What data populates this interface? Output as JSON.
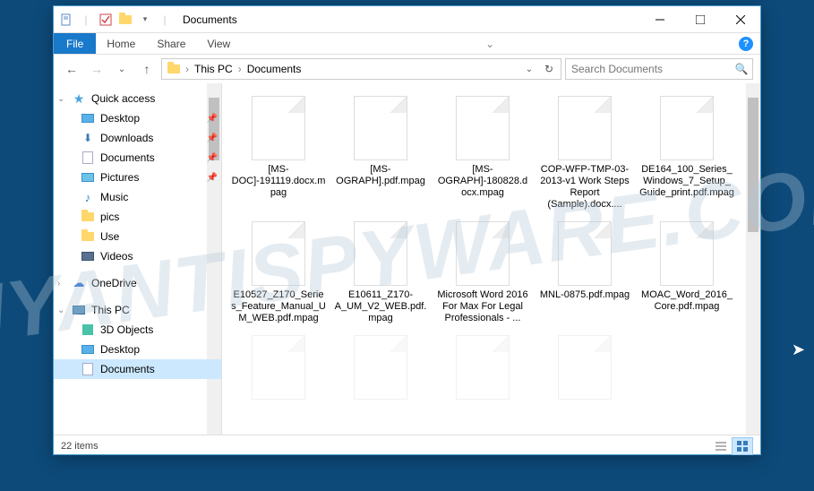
{
  "title": "Documents",
  "ribbon": {
    "file": "File",
    "home": "Home",
    "share": "Share",
    "view": "View"
  },
  "breadcrumb": {
    "root": "This PC",
    "current": "Documents"
  },
  "search": {
    "placeholder": "Search Documents"
  },
  "sidebar": {
    "quick": "Quick access",
    "pinned": [
      {
        "label": "Desktop"
      },
      {
        "label": "Downloads"
      },
      {
        "label": "Documents"
      },
      {
        "label": "Pictures"
      }
    ],
    "recent": [
      {
        "label": "Music"
      },
      {
        "label": "pics"
      },
      {
        "label": "Use"
      },
      {
        "label": "Videos"
      }
    ],
    "onedrive": "OneDrive",
    "thispc": "This PC",
    "pc_children": [
      {
        "label": "3D Objects"
      },
      {
        "label": "Desktop"
      },
      {
        "label": "Documents"
      }
    ]
  },
  "files": [
    {
      "name": "[MS-DOC]-191119.docx.mpag"
    },
    {
      "name": "[MS-OGRAPH].pdf.mpag"
    },
    {
      "name": "[MS-OGRAPH]-180828.docx.mpag"
    },
    {
      "name": "COP-WFP-TMP-03-2013-v1 Work Steps Report (Sample).docx...."
    },
    {
      "name": "DE164_100_Series_Windows_7_Setup_Guide_print.pdf.mpag"
    },
    {
      "name": "E10527_Z170_Series_Feature_Manual_UM_WEB.pdf.mpag"
    },
    {
      "name": "E10611_Z170-A_UM_V2_WEB.pdf.mpag"
    },
    {
      "name": "Microsoft Word 2016 For Max For Legal Professionals - ..."
    },
    {
      "name": "MNL-0875.pdf.mpag"
    },
    {
      "name": "MOAC_Word_2016_Core.pdf.mpag"
    }
  ],
  "status": {
    "count": "22 items"
  },
  "watermark": "MYANTISPYWARE.COM"
}
